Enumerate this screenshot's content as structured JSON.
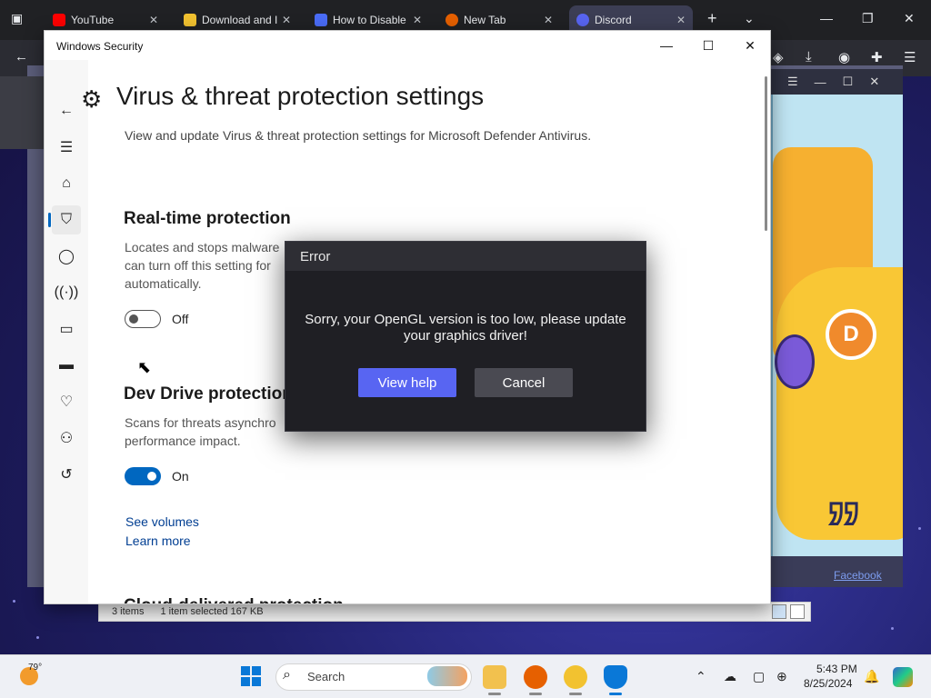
{
  "browser": {
    "tabs": [
      {
        "label": "YouTube",
        "color": "#ff0000"
      },
      {
        "label": "Download and I",
        "color": "#f2c230"
      },
      {
        "label": "How to Disable",
        "color": "#4a6cf7"
      },
      {
        "label": "New Tab",
        "color": "#e66000"
      },
      {
        "label": "Discord",
        "color": "#5865f2"
      }
    ]
  },
  "background_app": {
    "footer_link": "Facebook",
    "badge_letter": "D"
  },
  "explorer": {
    "item_count": "3 items",
    "selection": "1 item selected  167 KB"
  },
  "windows_security": {
    "window_title": "Windows Security",
    "page_title": "Virus & threat protection settings",
    "page_description": "View and update Virus & threat protection settings for Microsoft Defender Antivirus.",
    "realtime": {
      "heading": "Real-time protection",
      "text": "Locates and stops malware can turn off this setting for automatically.",
      "toggle_state": "Off"
    },
    "devdrive": {
      "heading": "Dev Drive protection",
      "text": "Scans for threats asynchro performance impact.",
      "toggle_state": "On"
    },
    "links": {
      "see_volumes": "See volumes",
      "learn_more": "Learn more"
    },
    "cut_heading": "Cloud-delivered protection",
    "accent_color": "#0067c0"
  },
  "error_dialog": {
    "title": "Error",
    "message": "Sorry, your OpenGL version is too low, please update your graphics driver!",
    "primary_button": "View help",
    "secondary_button": "Cancel",
    "primary_color": "#5865f2"
  },
  "taskbar": {
    "temperature": "79°",
    "search_placeholder": "Search",
    "time": "5:43 PM",
    "date": "8/25/2024"
  }
}
